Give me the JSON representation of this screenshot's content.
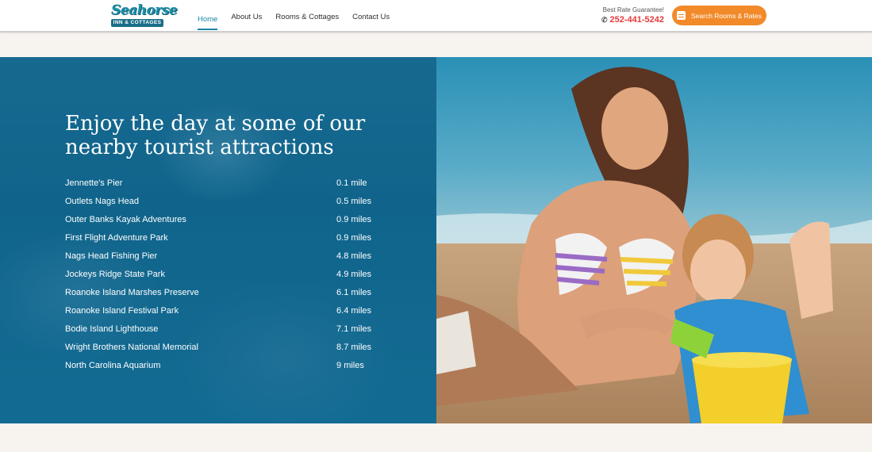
{
  "header": {
    "logo_line1": "Seahorse",
    "logo_line2": "INN & COTTAGES",
    "nav": [
      {
        "label": "Home"
      },
      {
        "label": "About Us"
      },
      {
        "label": "Rooms & Cottages"
      },
      {
        "label": "Contact Us"
      }
    ],
    "rate_label": "Best Rate Guarantee!",
    "phone": "252-441-5242",
    "search_button": "Search Rooms & Rates"
  },
  "hero": {
    "title": "Enjoy the day at some of our nearby tourist attractions",
    "attractions": [
      {
        "name": "Jennette's Pier",
        "distance": "0.1 mile"
      },
      {
        "name": "Outlets Nags Head",
        "distance": "0.5 miles"
      },
      {
        "name": "Outer Banks Kayak Adventures",
        "distance": "0.9 miles"
      },
      {
        "name": "First Flight Adventure Park",
        "distance": "0.9 miles"
      },
      {
        "name": "Nags Head Fishing Pier",
        "distance": "4.8 miles"
      },
      {
        "name": "Jockeys Ridge State Park",
        "distance": "4.9 miles"
      },
      {
        "name": "Roanoke Island Marshes Preserve",
        "distance": "6.1 miles"
      },
      {
        "name": "Roanoke Island Festival Park",
        "distance": "6.4 miles"
      },
      {
        "name": "Bodie Island Lighthouse",
        "distance": "7.1 miles"
      },
      {
        "name": "Wright Brothers National Memorial",
        "distance": "8.7 miles"
      },
      {
        "name": "North Carolina Aquarium",
        "distance": "9 miles"
      }
    ]
  },
  "colors": {
    "accent": "#1c88a6",
    "cta": "#f28a2a",
    "phone": "#e63a3a",
    "panel": "#15688e"
  },
  "icons": [
    "phone-icon",
    "calendar-icon"
  ]
}
